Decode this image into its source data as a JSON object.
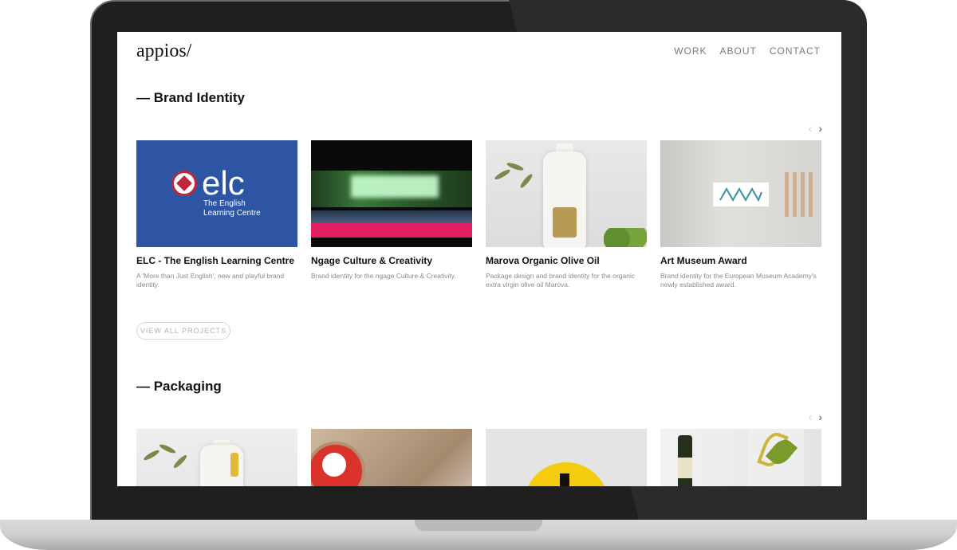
{
  "site": {
    "logo": "appios/",
    "nav": [
      {
        "label": "WORK"
      },
      {
        "label": "ABOUT"
      },
      {
        "label": "CONTACT"
      }
    ]
  },
  "brand_identity": {
    "title": "— Brand Identity",
    "prev_arrow": "‹",
    "next_arrow": "›",
    "cards": [
      {
        "title": "ELC - The English Learning Centre",
        "description": "A 'More than Just English', new and playful brand identity.",
        "thumb_text": {
          "word": "elc",
          "sub": "The English Learning Centre"
        }
      },
      {
        "title": "Ngage Culture & Creativity",
        "description": "Brand identity for the ngage Culture & Creativity."
      },
      {
        "title": "Marova Organic Olive Oil",
        "description": "Package design and brand identity for the organic extra virgin olive oil Marova."
      },
      {
        "title": "Art Museum Award",
        "description": "Brand identity for the European Museum Academy's newly established award."
      }
    ],
    "view_all_label": "VIEW ALL PROJECTS"
  },
  "packaging": {
    "title": "— Packaging",
    "prev_arrow": "‹",
    "next_arrow": "›"
  },
  "icons": {
    "prev": "chevron-left-icon",
    "next": "chevron-right-icon"
  },
  "colors": {
    "elc_blue": "#2d55a4",
    "ngage_pink": "#e41e63",
    "packaging_yellow": "#f5cb0e",
    "text_primary": "#111111",
    "text_muted": "#8a8a8a",
    "nav_text": "#7a7a7a"
  }
}
